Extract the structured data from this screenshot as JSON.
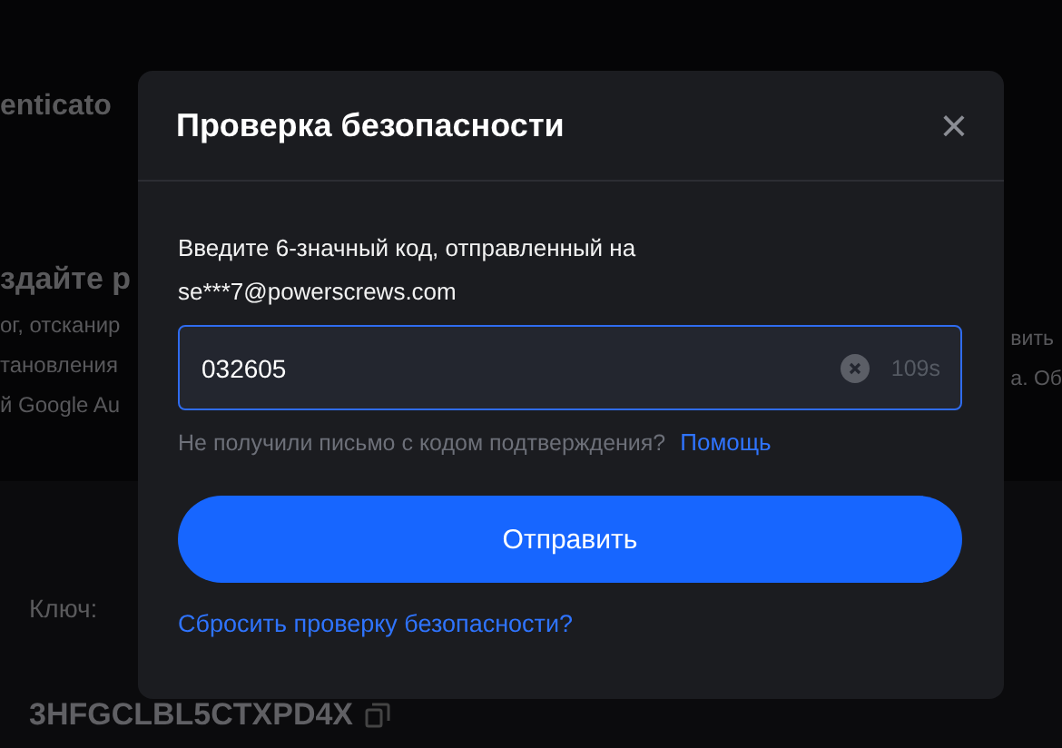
{
  "background": {
    "title": "enticato",
    "heading": "здайте р",
    "lines_left": [
      "ог, отсканир",
      "тановления",
      "й Google Au"
    ],
    "lines_right": [
      "вить",
      "а. Об"
    ],
    "key_label": "Ключ:",
    "key_value": "3HFGCLBL5CTXPD4X"
  },
  "dialog": {
    "title": "Проверка безопасности",
    "close": "×",
    "prompt": "Введите 6-значный код, отправленный на",
    "email": "se***7@powerscrews.com",
    "code_field": {
      "value": "032605",
      "countdown": "109s"
    },
    "help_text": "Не получили письмо с кодом подтверждения?",
    "help_link": "Помощь",
    "submit": "Отправить",
    "reset_link": "Сбросить проверку безопасности?"
  }
}
